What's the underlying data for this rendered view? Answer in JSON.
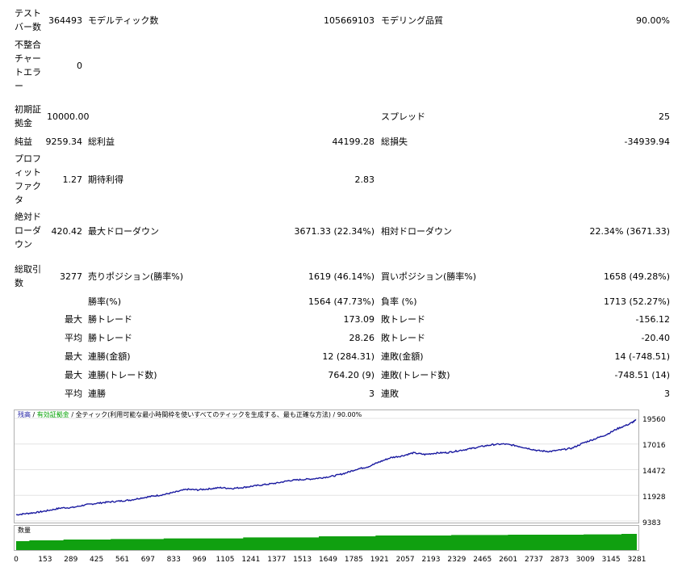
{
  "report": {
    "bars_label": "テストバー数",
    "bars_value": "364493",
    "ticks_label": "モデルティック数",
    "ticks_value": "105669103",
    "quality_label": "モデリング品質",
    "quality_value": "90.00%",
    "mismatch_label": "不整合チャートエラー",
    "mismatch_value": "0",
    "deposit_label": "初期証拠金",
    "deposit_value": "10000.00",
    "spread_label": "スプレッド",
    "spread_value": "25",
    "net_label": "純益",
    "net_value": "9259.34",
    "gross_profit_label": "総利益",
    "gross_profit_value": "44199.28",
    "gross_loss_label": "総損失",
    "gross_loss_value": "-34939.94",
    "pf_label": "プロフィットファクタ",
    "pf_value": "1.27",
    "expected_label": "期待利得",
    "expected_value": "2.83",
    "abs_dd_label": "絶対ドローダウン",
    "abs_dd_value": "420.42",
    "max_dd_label": "最大ドローダウン",
    "max_dd_value": "3671.33 (22.34%)",
    "rel_dd_label": "相対ドローダウン",
    "rel_dd_value": "22.34% (3671.33)",
    "total_trades_label": "総取引数",
    "total_trades_value": "3277",
    "short_label": "売りポジション(勝率%)",
    "short_value": "1619 (46.14%)",
    "long_label": "買いポジション(勝率%)",
    "long_value": "1658 (49.28%)",
    "win_rate_label": "勝率(%)",
    "win_rate_value": "1564 (47.73%)",
    "loss_rate_label": "負率 (%)",
    "loss_rate_value": "1713 (52.27%)",
    "max_word": "最大",
    "avg_word": "平均",
    "largest_win_label": "勝トレード",
    "largest_win_value": "173.09",
    "largest_loss_label": "敗トレード",
    "largest_loss_value": "-156.12",
    "avg_win_label": "勝トレード",
    "avg_win_value": "28.26",
    "avg_loss_label": "敗トレード",
    "avg_loss_value": "-20.40",
    "max_cons_win_label": "連勝(金額)",
    "max_cons_win_value": "12 (284.31)",
    "max_cons_loss_label": "連敗(金額)",
    "max_cons_loss_value": "14 (-748.51)",
    "max_cons_profit_label": "連勝(トレード数)",
    "max_cons_profit_value": "764.20 (9)",
    "max_cons_lossamt_label": "連敗(トレード数)",
    "max_cons_lossamt_value": "-748.51 (14)",
    "avg_cons_win_label": "連勝",
    "avg_cons_win_value": "3",
    "avg_cons_loss_label": "連敗",
    "avg_cons_loss_value": "3"
  },
  "chart": {
    "legend_balance": "残高",
    "legend_sep1": " / ",
    "legend_equity": "有効証拠金",
    "legend_sep2": " / ",
    "legend_model": "全ティック(利用可能な最小時間枠を使いすべてのティックを生成する、最も正確な方法)",
    "legend_sep3": " / ",
    "legend_quality": "90.00%",
    "volume_label": "数量",
    "colors": {
      "balance": "#1a1aa0",
      "equity": "#00a000",
      "volume": "#10a010"
    }
  },
  "chart_data": {
    "type": "line",
    "series": [
      {
        "name": "残高",
        "points": [
          [
            0,
            10000
          ],
          [
            60,
            10130
          ],
          [
            120,
            10260
          ],
          [
            180,
            10460
          ],
          [
            240,
            10680
          ],
          [
            300,
            10720
          ],
          [
            360,
            10960
          ],
          [
            420,
            11120
          ],
          [
            480,
            11250
          ],
          [
            540,
            11340
          ],
          [
            600,
            11450
          ],
          [
            660,
            11660
          ],
          [
            720,
            11840
          ],
          [
            780,
            12000
          ],
          [
            840,
            12240
          ],
          [
            900,
            12520
          ],
          [
            960,
            12470
          ],
          [
            1020,
            12570
          ],
          [
            1080,
            12690
          ],
          [
            1140,
            12610
          ],
          [
            1200,
            12710
          ],
          [
            1260,
            12860
          ],
          [
            1320,
            13010
          ],
          [
            1380,
            13150
          ],
          [
            1440,
            13380
          ],
          [
            1500,
            13480
          ],
          [
            1560,
            13550
          ],
          [
            1620,
            13680
          ],
          [
            1680,
            13850
          ],
          [
            1740,
            14130
          ],
          [
            1800,
            14520
          ],
          [
            1860,
            14760
          ],
          [
            1920,
            15240
          ],
          [
            1980,
            15660
          ],
          [
            2040,
            15840
          ],
          [
            2100,
            16140
          ],
          [
            2160,
            15980
          ],
          [
            2220,
            16120
          ],
          [
            2280,
            16170
          ],
          [
            2340,
            16360
          ],
          [
            2400,
            16550
          ],
          [
            2460,
            16770
          ],
          [
            2520,
            16960
          ],
          [
            2580,
            17020
          ],
          [
            2640,
            16860
          ],
          [
            2700,
            16610
          ],
          [
            2760,
            16350
          ],
          [
            2820,
            16280
          ],
          [
            2880,
            16430
          ],
          [
            2940,
            16610
          ],
          [
            3000,
            17140
          ],
          [
            3060,
            17530
          ],
          [
            3120,
            17950
          ],
          [
            3180,
            18550
          ],
          [
            3240,
            18990
          ],
          [
            3277,
            19380
          ]
        ]
      }
    ],
    "y_ticks": [
      "19560",
      "17016",
      "14472",
      "11928",
      "9383"
    ],
    "x_ticks": [
      "0",
      "153",
      "289",
      "425",
      "561",
      "697",
      "833",
      "969",
      "1105",
      "1241",
      "1377",
      "1513",
      "1649",
      "1785",
      "1921",
      "2057",
      "2193",
      "2329",
      "2465",
      "2601",
      "2737",
      "2873",
      "3009",
      "3145",
      "3281"
    ],
    "ylim": [
      9383,
      19560
    ],
    "xlim": [
      0,
      3281
    ],
    "volume": {
      "steps": [
        [
          0,
          0.55
        ],
        [
          70,
          0.6
        ],
        [
          250,
          0.65
        ],
        [
          500,
          0.68
        ],
        [
          780,
          0.72
        ],
        [
          1200,
          0.78
        ],
        [
          1600,
          0.85
        ],
        [
          1900,
          0.9
        ],
        [
          2300,
          0.93
        ],
        [
          2600,
          0.95
        ],
        [
          3000,
          0.97
        ],
        [
          3200,
          1.0
        ]
      ]
    }
  }
}
